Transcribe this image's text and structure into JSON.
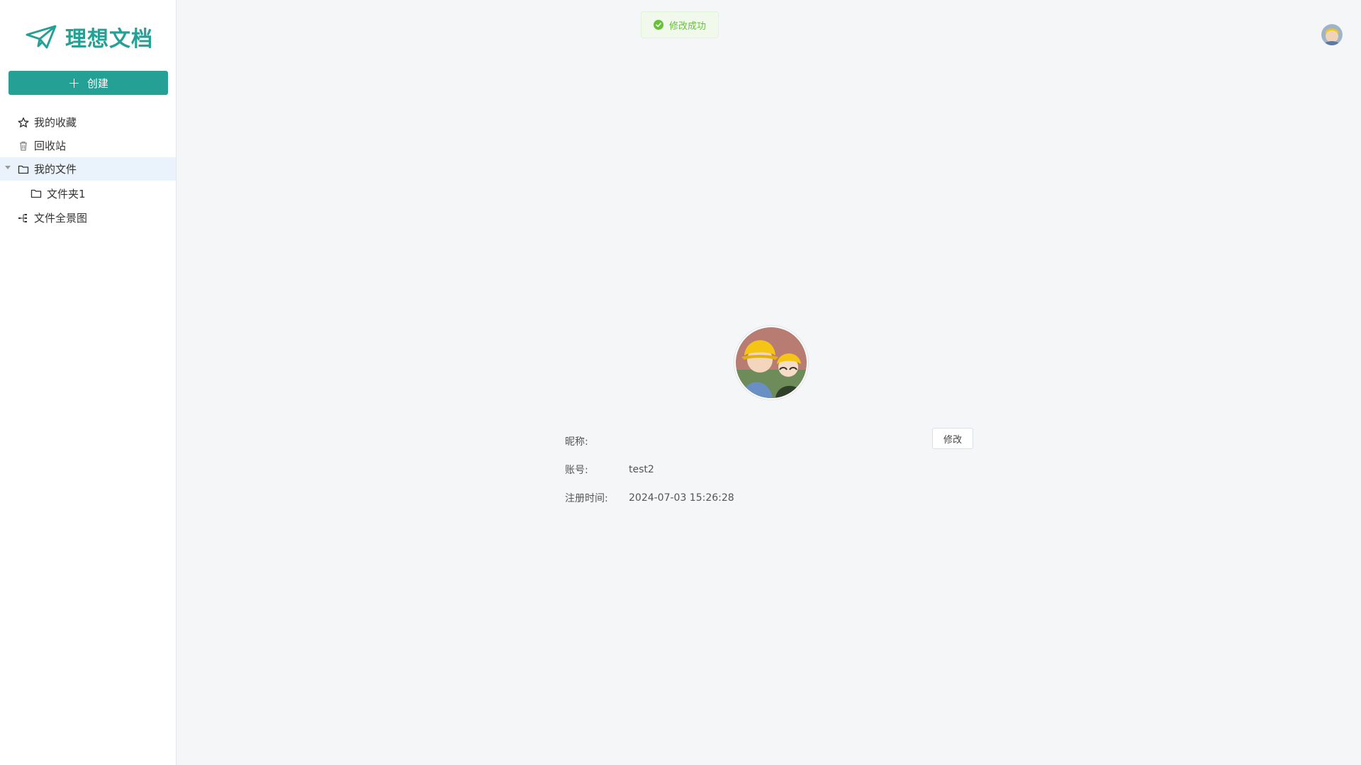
{
  "brand": {
    "name": "理想文档",
    "color": "#25a094"
  },
  "toolbar": {
    "create_label": "创建"
  },
  "nav": {
    "items": [
      {
        "label": "我的收藏",
        "icon": "star-icon"
      },
      {
        "label": "回收站",
        "icon": "trash-icon"
      },
      {
        "label": "我的文件",
        "icon": "folder-icon",
        "expanded": true,
        "active": true
      },
      {
        "label": "文件夹1",
        "icon": "folder-icon"
      },
      {
        "label": "文件全景图",
        "icon": "tree-icon"
      }
    ]
  },
  "toast": {
    "message": "修改成功",
    "type": "success"
  },
  "profile": {
    "nickname_label": "昵称:",
    "nickname_value": "",
    "edit_label": "修改",
    "account_label": "账号:",
    "account_value": "test2",
    "register_label": "注册时间:",
    "register_value": "2024-07-03 15:26:28"
  }
}
